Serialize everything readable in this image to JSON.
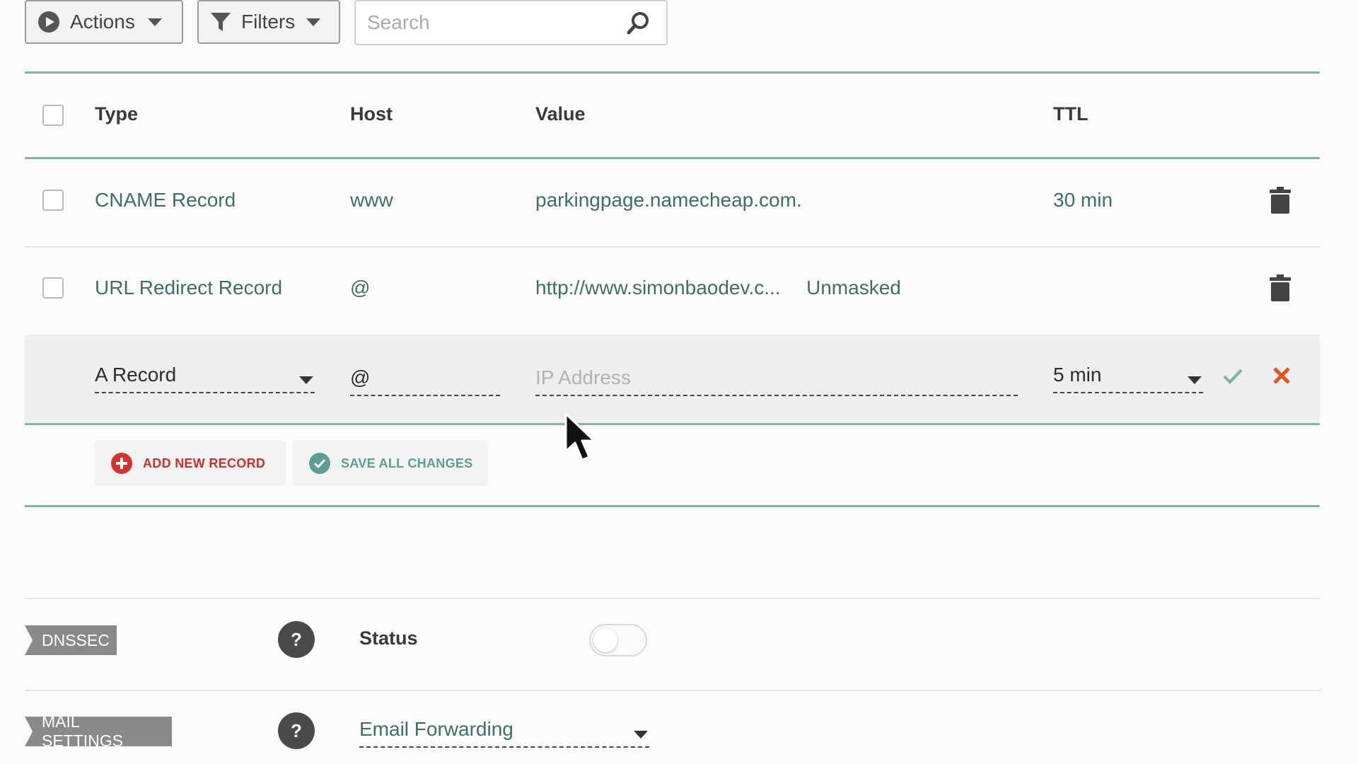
{
  "toolbar": {
    "actions_label": "Actions",
    "filters_label": "Filters",
    "search_placeholder": "Search"
  },
  "table": {
    "columns": [
      "Type",
      "Host",
      "Value",
      "TTL"
    ],
    "rows": [
      {
        "type": "CNAME Record",
        "host": "www",
        "value": "parkingpage.namecheap.com.",
        "ttl": "30 min"
      },
      {
        "type": "URL Redirect Record",
        "host": "@",
        "value": "http://www.simonbaodev.c...",
        "extra": "Unmasked",
        "ttl": ""
      }
    ]
  },
  "edit_row": {
    "type_value": "A Record",
    "host_value": "@",
    "value_placeholder": "IP Address",
    "ttl_value": "5 min"
  },
  "record_actions": {
    "add_label": "ADD NEW RECORD",
    "save_label": "SAVE ALL CHANGES"
  },
  "dnssec": {
    "tag": "DNSSEC",
    "status_label": "Status",
    "enabled": false
  },
  "mail": {
    "tag": "MAIL SETTINGS",
    "selected": "Email Forwarding"
  },
  "colors": {
    "accent_teal": "#7fb3a8",
    "link_text": "#3d6e68",
    "add_red": "#c8322c",
    "save_teal": "#5b9e95",
    "cancel_orange": "#e8501e"
  }
}
